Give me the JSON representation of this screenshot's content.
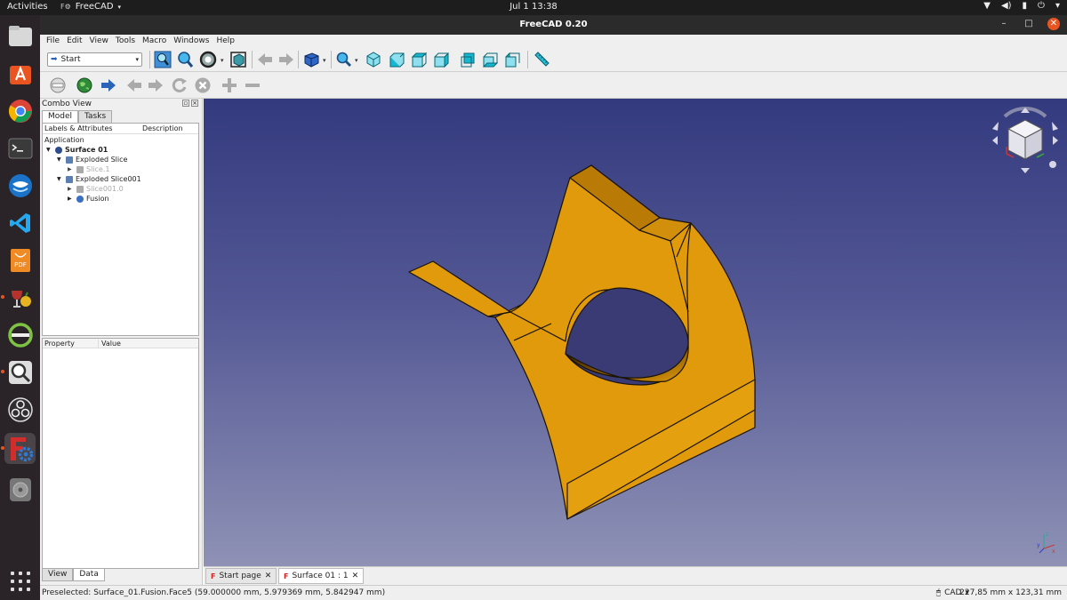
{
  "system": {
    "activities": "Activities",
    "app_name": "FreeCAD",
    "clock": "Jul 1  13:38",
    "tray_network": "▼",
    "tray_volume": "◀)",
    "tray_battery": "▮",
    "tray_power": "⏻",
    "tray_menu": "▾"
  },
  "window": {
    "title": "FreeCAD 0.20",
    "minimize": "–",
    "maximize": "□",
    "close": "✕"
  },
  "menu": {
    "items": [
      "File",
      "Edit",
      "View",
      "Tools",
      "Macro",
      "Windows",
      "Help"
    ]
  },
  "toolbar": {
    "workbench": "Start",
    "workbench_caret": "▾",
    "dropdown_caret": "▾"
  },
  "combo_view": {
    "title": "Combo View",
    "tabs": [
      "Model",
      "Tasks"
    ],
    "tree_columns": [
      "Labels & Attributes",
      "Description"
    ],
    "tree": [
      {
        "label": "Application",
        "arrow": ""
      },
      {
        "label": "Surface 01",
        "arrow": "▼"
      },
      {
        "label": "Exploded Slice",
        "arrow": "▼"
      },
      {
        "label": "Slice.1",
        "arrow": "▶"
      },
      {
        "label": "Exploded Slice001",
        "arrow": "▼"
      },
      {
        "label": "Slice001.0",
        "arrow": "▶"
      },
      {
        "label": "Fusion",
        "arrow": "▶"
      }
    ],
    "property_columns": [
      "Property",
      "Value"
    ],
    "bottom_tabs": [
      "View",
      "Data"
    ]
  },
  "doc_tabs": [
    {
      "label": "Start page",
      "close": "✕"
    },
    {
      "label": "Surface 01 : 1",
      "close": "✕"
    }
  ],
  "status": {
    "message": "Preselected: Surface_01.Fusion.Face5 (59.000000 mm, 5.979369 mm, 5.842947 mm)",
    "nav_style": "CAD",
    "nav_caret": "▾",
    "dimensions": "227,85 mm x 123,31 mm"
  },
  "axes": {
    "x": "x",
    "y": "y",
    "z": "z"
  },
  "colors": {
    "model_face": "#e09a0c",
    "model_edge": "#1a1300",
    "view_top": "#333a7e",
    "view_bottom": "#8f92b5",
    "accent": "#e95420"
  }
}
